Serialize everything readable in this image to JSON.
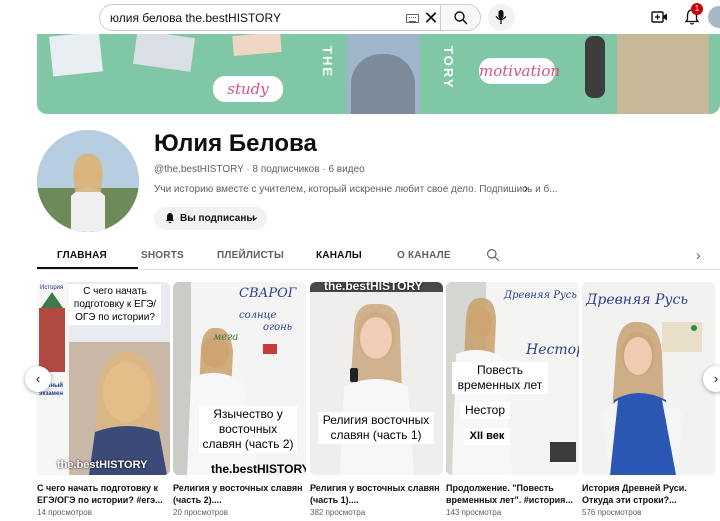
{
  "search": {
    "query": "юлия белова the.bestHISTORY"
  },
  "icons": {
    "keyboard": "keyboard-icon",
    "clear": "close-icon",
    "search": "search-icon",
    "mic": "mic-icon",
    "create": "video-plus-icon",
    "bell": "bell-icon",
    "clear_glyph": "✕",
    "desc_arrow_glyph": "›",
    "chevron_glyph": "⌄",
    "prev_glyph": "‹",
    "next_glyph": "›"
  },
  "notifications": {
    "count": "1"
  },
  "banner": {
    "study_label": "study",
    "motivation_label": "motivation",
    "vertical_left": "THE",
    "vertical_right": "TORY"
  },
  "channel": {
    "name": "Юлия Белова",
    "handle": "@the.bestHISTORY",
    "subscribers": "8 подписчиков",
    "videos": "6 видео",
    "separator": "·",
    "description": "Учи историю вместе с учителем, который искренне любит свое дело. Подпишись и б...",
    "subscribe_label": "Вы подписаны"
  },
  "tabs": [
    {
      "label": "ГЛАВНАЯ"
    },
    {
      "label": "SHORTS"
    },
    {
      "label": "ПЛЕЙЛИСТЫ"
    },
    {
      "label": "КАНАЛЫ"
    },
    {
      "label": "О КАНАЛЕ"
    }
  ],
  "videos": [
    {
      "title": "С чего начать подготовку к ЕГЭ/ОГЭ по истории? #егэ...",
      "views": "14 просмотров",
      "thumb_text": "С чего начать подготовку к ЕГЭ/ ОГЭ по истории?",
      "thumb_brand": "the.bestHISTORY",
      "thumb_header": "История",
      "thumb_side": "Единый экзамен"
    },
    {
      "title": "Религия у восточных славян (часть 2)....",
      "views": "20 просмотров",
      "thumb_text": "Язычество у восточных славян (часть 2)",
      "thumb_brand": "the.bestHISTORY",
      "board": [
        "СВАРОГ",
        "огонь",
        "солнце",
        "мега"
      ]
    },
    {
      "title": "Религия у восточных славян (часть 1)....",
      "views": "382 просмотра",
      "thumb_text": "Религия восточных славян (часть 1)",
      "thumb_brand": "the.bestHISTORY"
    },
    {
      "title": "Продолжение. \"Повесть временных лет\". #история...",
      "views": "143 просмотра",
      "thumb_caption1": "Повесть временных лет",
      "thumb_caption2": "Нестор",
      "thumb_caption3": "XII век",
      "board": [
        "Древняя Русь",
        "Нестор"
      ]
    },
    {
      "title": "История Древней Руси. Откуда эти строки?...",
      "views": "576 просмотров",
      "board": [
        "Древняя Русь"
      ]
    }
  ],
  "colors": {
    "banner": "#7fc7a5",
    "accent_pink": "#d64f91",
    "badge": "#cc0000",
    "text_primary": "#0f0f0f",
    "text_secondary": "#606060"
  }
}
